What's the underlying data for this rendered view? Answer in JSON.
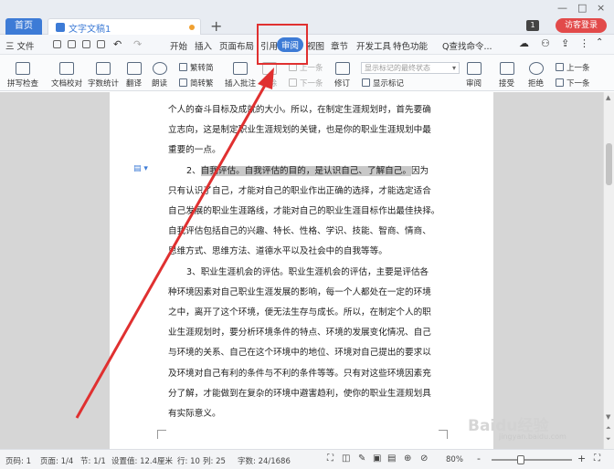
{
  "tabs": {
    "home": "首页",
    "doc": "文字文稿1",
    "add": "+"
  },
  "window": {
    "badge": "1",
    "login": "访客登录",
    "minimize": "—",
    "restore": "□",
    "close": "×"
  },
  "menu": {
    "file": "三 文件",
    "start": "开始",
    "insert": "插入",
    "layout": "页面布局",
    "reference": "引用",
    "review": "审阅",
    "view": "视图",
    "section": "章节",
    "dev": "开发工具",
    "special": "特色功能",
    "search": "Q查找命令..."
  },
  "ribbon": {
    "spell": "拼写检查",
    "proof": "文档校对",
    "wordcount": "字数统计",
    "translate": "翻译",
    "read": "朗读",
    "trad": "繁转简",
    "simp": "简转繁",
    "addcomment": "插入批注",
    "delete": "删除",
    "prev_comment": "上一条",
    "next_comment": "下一条",
    "revise": "修订",
    "markup_select": "显示标记的最终状态",
    "show_markup": "显示标记",
    "review_pane": "审阅",
    "accept": "接受",
    "reject": "拒绝",
    "prev": "上一条",
    "next": "下一条"
  },
  "document": {
    "lines": [
      "个人的奋斗目标及成就的大小。所以，在制定生涯规划时，首先要确",
      "立志向，这是制定职业生涯规划的关键，也是你的职业生涯规划中最",
      "重要的一点。",
      "2、",
      "自我评估。自我评估的目的，是认识自己、了解自己。",
      "因为",
      "只有认识了自己，才能对自己的职业作出正确的选择，才能选定适合",
      "自己发展的职业生涯路线，才能对自己的职业生涯目标作出最佳抉择。",
      "自我评估包括自己的兴趣、特长、性格、学识、技能、智商、情商、",
      "思维方式、思维方法、道德水平以及社会中的自我等等。",
      "3、职业生涯机会的评估。职业生涯机会的评估，主要是评估各",
      "种环境因素对自己职业生涯发展的影响，每一个人都处在一定的环境",
      "之中，离开了这个环境，便无法生存与成长。所以，在制定个人的职",
      "业生涯规划时，要分析环境条件的特点、环境的发展变化情况、自己",
      "与环境的关系、自己在这个环境中的地位、环境对自己提出的要求以",
      "及环境对自己有利的条件与不利的条件等等。只有对这些环境因素充",
      "分了解，才能做到在复杂的环境中避害趋利，使你的职业生涯规划具",
      "有实际意义。"
    ]
  },
  "status": {
    "page": "页码: 1",
    "pages": "页面: 1/4",
    "section": "节: 1/1",
    "setting": "设置值: 12.4厘米",
    "row": "行: 10",
    "col": "列: 25",
    "words": "字数: 24/1686",
    "zoom": "80%",
    "zoom_minus": "-",
    "zoom_plus": "+"
  },
  "watermark": {
    "brand": "Baidu经验",
    "url": "jingyan.baidu.com"
  },
  "colors": {
    "accent": "#3d7bd6",
    "annotation": "#e03030",
    "selection": "#c8c8c8"
  }
}
